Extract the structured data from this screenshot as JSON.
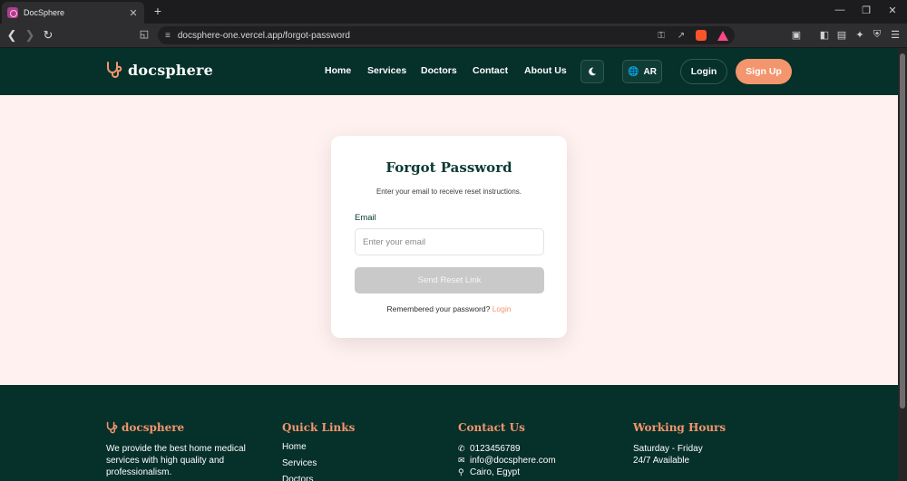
{
  "browser": {
    "tab_title": "DocSphere",
    "tab_close": "✕",
    "new_tab": "+",
    "url": "docsphere-one.vercel.app/forgot-password"
  },
  "header": {
    "brand": "docsphere",
    "nav": [
      "Home",
      "Services",
      "Doctors",
      "Contact",
      "About Us"
    ],
    "lang_label": "AR",
    "login_label": "Login",
    "signup_label": "Sign Up"
  },
  "card": {
    "title": "Forgot Password",
    "subtitle": "Enter your email to receive reset instructions.",
    "email_label": "Email",
    "email_placeholder": "Enter your email",
    "email_value": "",
    "submit_label": "Send Reset Link",
    "remember_text": "Remembered your password?",
    "remember_link": "Login"
  },
  "footer": {
    "brand": "docsphere",
    "about_text": "We provide the best home medical services with high quality and professionalism.",
    "quick_links_heading": "Quick Links",
    "quick_links": [
      "Home",
      "Services",
      "Doctors"
    ],
    "contact_heading": "Contact Us",
    "phone": "0123456789",
    "email": "info@docsphere.com",
    "location": "Cairo, Egypt",
    "hours_heading": "Working Hours",
    "hours_days": "Saturday - Friday",
    "hours_availability": "24/7 Available"
  },
  "colors": {
    "primary_dark": "#06302a",
    "accent": "#f3956d",
    "page_bg": "#fff1ef",
    "button_disabled": "#c9c9c9"
  },
  "icons": [
    "stethoscope-icon",
    "moon-icon",
    "globe-icon",
    "phone-icon",
    "envelope-icon",
    "map-pin-icon"
  ]
}
